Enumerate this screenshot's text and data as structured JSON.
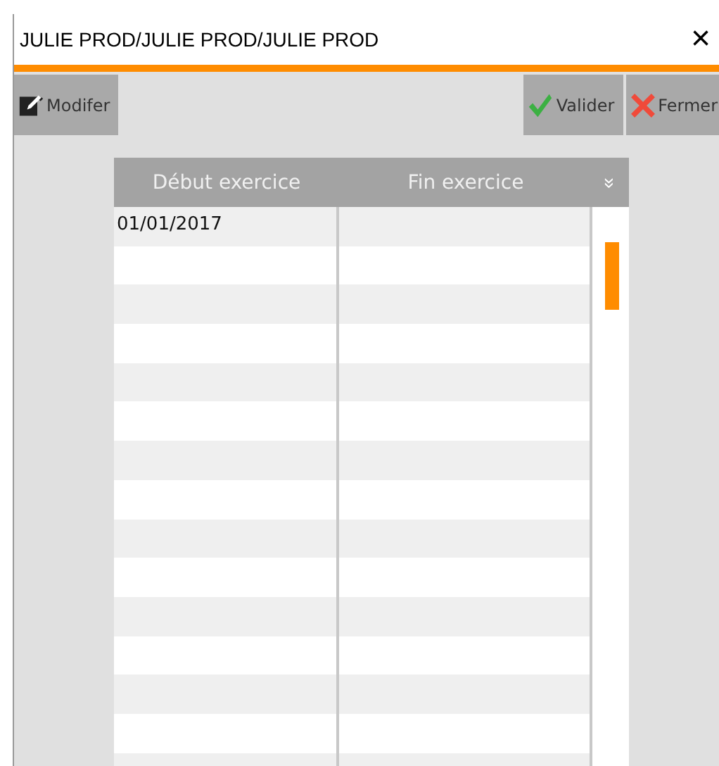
{
  "window": {
    "title": "JULIE PROD/JULIE PROD/JULIE PROD",
    "close": "×"
  },
  "toolbar": {
    "left": [
      {
        "label": "Modifer",
        "kind": "edit"
      }
    ],
    "right": [
      {
        "label": "Valider",
        "kind": "ok"
      },
      {
        "label": "Fermer",
        "kind": "cancel"
      }
    ]
  },
  "table": {
    "columns": [
      "Début exercice",
      "Fin exercice"
    ],
    "menu": "»",
    "rows": [
      [
        "01/01/2017"
      ]
    ]
  }
}
